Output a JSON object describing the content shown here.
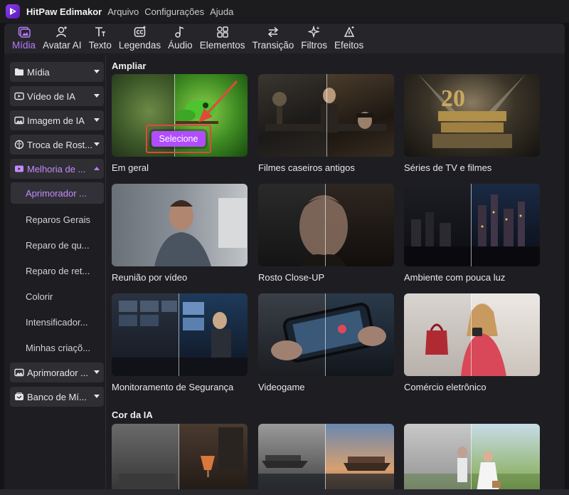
{
  "app": {
    "title": "HitPaw Edimakor",
    "menu": [
      "Arquivo",
      "Configurações",
      "Ajuda"
    ]
  },
  "toolbar": {
    "tabs": [
      {
        "label": "Mídia",
        "icon": "media-icon",
        "active": true
      },
      {
        "label": "Avatar AI",
        "icon": "avatar-icon"
      },
      {
        "label": "Texto",
        "icon": "text-icon"
      },
      {
        "label": "Legendas",
        "icon": "subtitles-icon"
      },
      {
        "label": "Áudio",
        "icon": "audio-icon"
      },
      {
        "label": "Elementos",
        "icon": "elements-icon"
      },
      {
        "label": "Transição",
        "icon": "transition-icon"
      },
      {
        "label": "Filtros",
        "icon": "filters-icon"
      },
      {
        "label": "Efeitos",
        "icon": "effects-icon"
      }
    ]
  },
  "sidebar": {
    "items": [
      {
        "label": "Mídia",
        "icon": "folder-icon"
      },
      {
        "label": "Vídeo de IA",
        "icon": "video-ai-icon"
      },
      {
        "label": "Imagem de IA",
        "icon": "image-ai-icon"
      },
      {
        "label": "Troca de Rost...",
        "icon": "face-swap-icon"
      },
      {
        "label": "Melhoria de ...",
        "icon": "enhance-icon",
        "active": true
      },
      {
        "label": "Aprimorador ...",
        "icon": "image-enhancer-icon"
      },
      {
        "label": "Banco de Mí...",
        "icon": "media-bank-icon"
      }
    ],
    "subitems": [
      {
        "label": "Aprimorador ...",
        "active": true
      },
      {
        "label": "Reparos Gerais"
      },
      {
        "label": "Reparo de qu..."
      },
      {
        "label": "Reparo de ret..."
      },
      {
        "label": "Colorir"
      },
      {
        "label": "Intensificador..."
      },
      {
        "label": "Minhas criaçõ..."
      }
    ]
  },
  "content": {
    "section1_title": "Ampliar",
    "section2_title": "Cor da IA",
    "select_label": "Selecione",
    "cards": [
      "Em geral",
      "Filmes caseiros antigos",
      "Séries de TV e filmes",
      "Reunião por vídeo",
      "Rosto Close-UP",
      "Ambiente com pouca luz",
      "Monitoramento de Segurança",
      "Videogame",
      "Comércio eletrônico"
    ],
    "color_cards": [
      "",
      "",
      ""
    ]
  },
  "colors": {
    "accent": "#b77bff",
    "select_button": "#b04dff",
    "highlight_box": "#e0483c"
  }
}
